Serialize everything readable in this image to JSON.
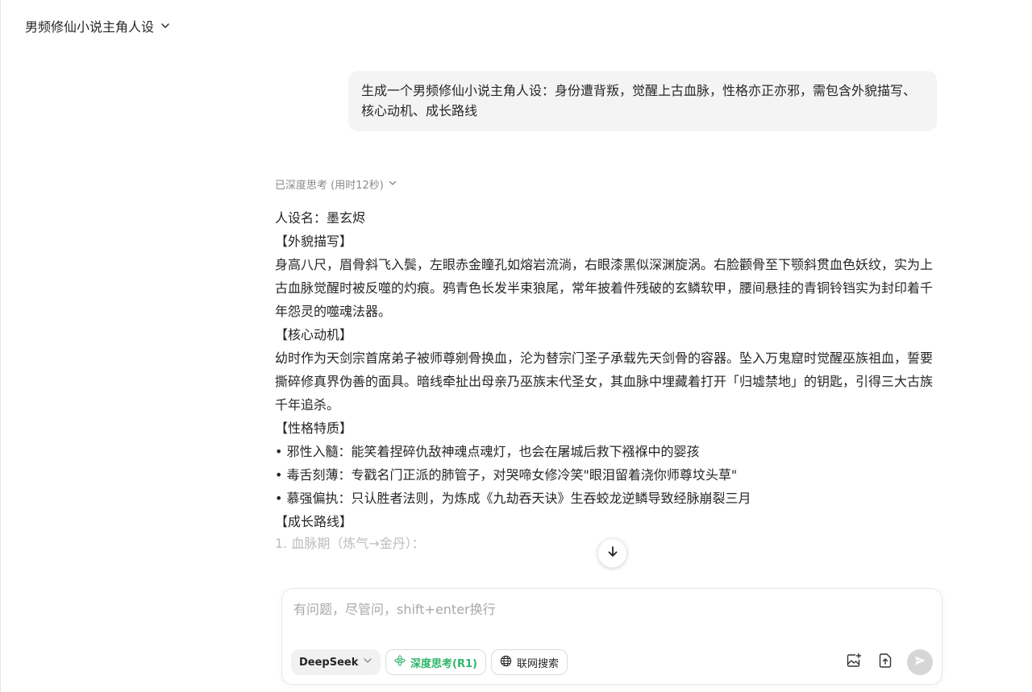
{
  "header": {
    "chat_title": "男频修仙小说主角人设"
  },
  "user_message": {
    "text": "生成一个男频修仙小说主角人设：身份遭背叛，觉醒上古血脉，性格亦正亦邪，需包含外貌描写、核心动机、成长路线"
  },
  "assistant": {
    "think_label": "已深度思考 (用时12秒)",
    "name_line": "人设名：墨玄烬",
    "appearance_heading": "【外貌描写】",
    "appearance_text": "身高八尺，眉骨斜飞入鬓，左眼赤金瞳孔如熔岩流淌，右眼漆黑似深渊旋涡。右脸颧骨至下颚斜贯血色妖纹，实为上古血脉觉醒时被反噬的灼痕。鸦青色长发半束狼尾，常年披着件残破的玄鳞软甲，腰间悬挂的青铜铃铛实为封印着千年怨灵的噬魂法器。",
    "motive_heading": "【核心动机】",
    "motive_text": "幼时作为天剑宗首席弟子被师尊剜骨换血，沦为替宗门圣子承载先天剑骨的容器。坠入万鬼窟时觉醒巫族祖血，誓要撕碎修真界伪善的面具。暗线牵扯出母亲乃巫族末代圣女，其血脉中埋藏着打开「归墟禁地」的钥匙，引得三大古族千年追杀。",
    "trait_heading": "【性格特质】",
    "traits": [
      "• 邪性入髓：能笑着捏碎仇敌神魂点魂灯，也会在屠城后救下襁褓中的婴孩",
      "• 毒舌刻薄：专戳名门正派的肺管子，对哭啼女修冷笑\"眼泪留着浇你师尊坟头草\"",
      "• 慕强偏执：只认胜者法则，为炼成《九劫吞天诀》生吞蛟龙逆鳞导致经脉崩裂三月"
    ],
    "growth_heading": "【成长路线】",
    "growth_first": "1. 血脉期（炼气→金丹）："
  },
  "composer": {
    "placeholder": "有问题，尽管问，shift+enter换行",
    "model_label": "DeepSeek",
    "deep_think_label": "深度思考(R1)",
    "web_search_label": "联网搜索"
  },
  "icons": {
    "title_dropdown": "chevron-down-icon",
    "think_toggle": "chevron-down-icon",
    "scroll_down": "arrow-down-icon",
    "model_dropdown": "chevron-down-icon",
    "deep_think": "atom-icon",
    "web_search": "globe-icon",
    "image_upload": "image-plus-icon",
    "file_upload": "upload-file-icon",
    "send": "send-icon"
  },
  "colors": {
    "deep_think_accent": "#2fb56a",
    "bubble_bg": "#f4f4f5",
    "send_disabled": "#d6d6d6"
  }
}
